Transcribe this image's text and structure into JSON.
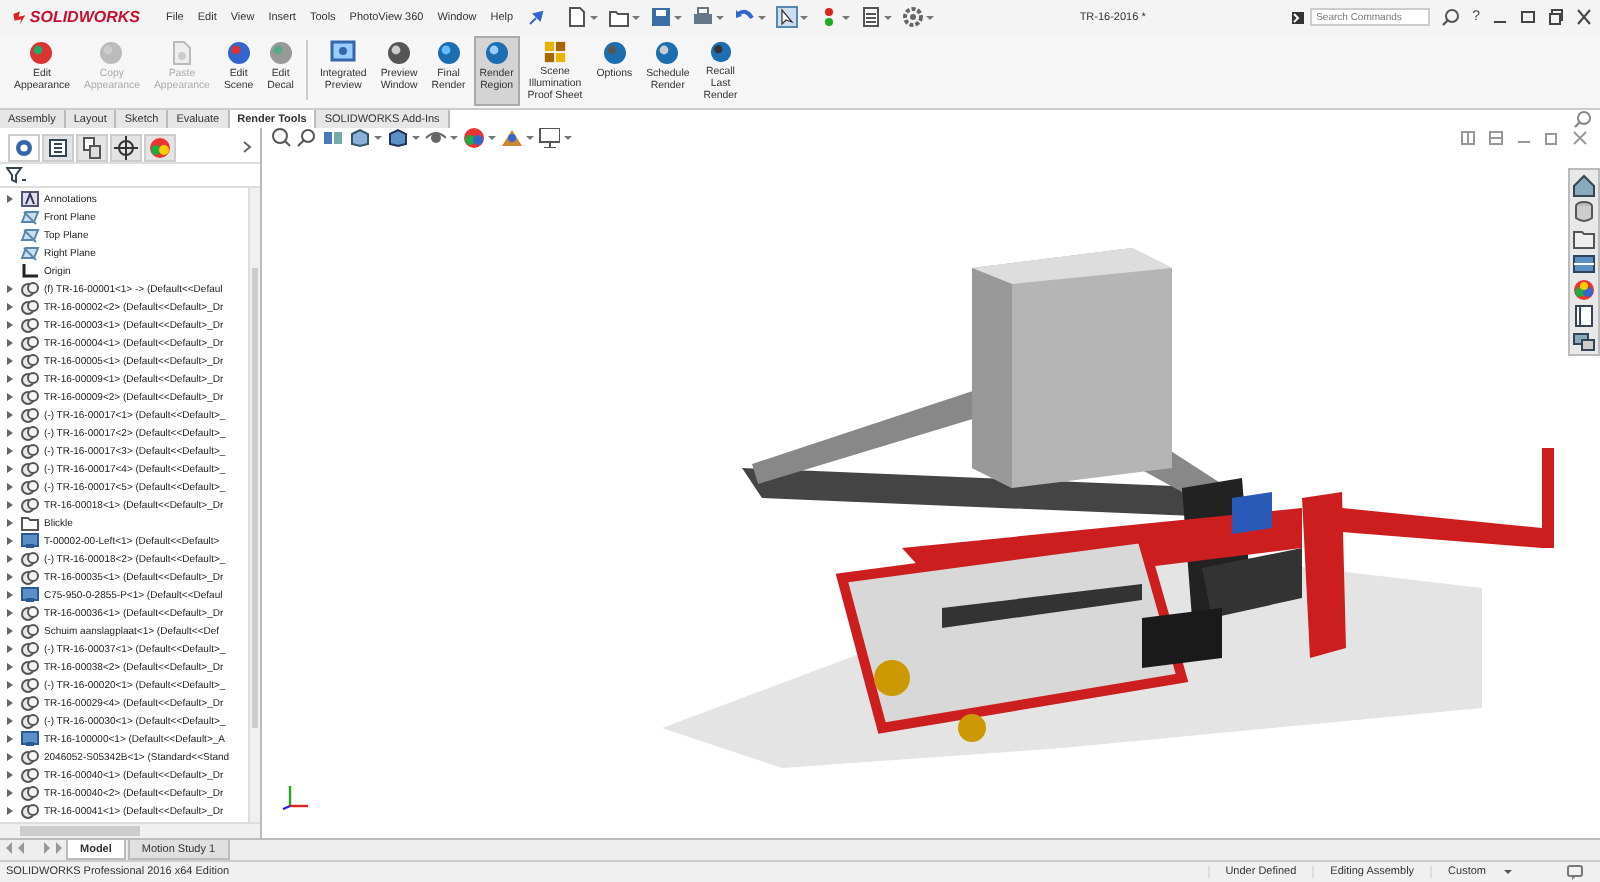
{
  "app": {
    "logo": "SOLIDWORKS"
  },
  "menu": [
    "File",
    "Edit",
    "View",
    "Insert",
    "Tools",
    "PhotoView 360",
    "Window",
    "Help"
  ],
  "document_title": "TR-16-2016 *",
  "search": {
    "placeholder": "Search Commands"
  },
  "help": "?",
  "ribbon": [
    {
      "label": "Edit\nAppearance",
      "disabled": false,
      "selected": false
    },
    {
      "label": "Copy\nAppearance",
      "disabled": true,
      "selected": false
    },
    {
      "label": "Paste\nAppearance",
      "disabled": true,
      "selected": false
    },
    {
      "label": "Edit\nScene",
      "disabled": false,
      "selected": false
    },
    {
      "label": "Edit\nDecal",
      "disabled": false,
      "selected": false
    },
    {
      "label": "Integrated\nPreview",
      "disabled": false,
      "selected": false
    },
    {
      "label": "Preview\nWindow",
      "disabled": false,
      "selected": false
    },
    {
      "label": "Final\nRender",
      "disabled": false,
      "selected": false
    },
    {
      "label": "Render\nRegion",
      "disabled": false,
      "selected": true
    },
    {
      "label": "Scene\nIllumination\nProof Sheet",
      "disabled": false,
      "selected": false
    },
    {
      "label": "Options",
      "disabled": false,
      "selected": false
    },
    {
      "label": "Schedule\nRender",
      "disabled": false,
      "selected": false
    },
    {
      "label": "Recall\nLast\nRender",
      "disabled": false,
      "selected": false
    }
  ],
  "command_tabs": [
    {
      "label": "Assembly",
      "selected": false
    },
    {
      "label": "Layout",
      "selected": false
    },
    {
      "label": "Sketch",
      "selected": false
    },
    {
      "label": "Evaluate",
      "selected": false
    },
    {
      "label": "Render Tools",
      "selected": true
    },
    {
      "label": "SOLIDWORKS Add-Ins",
      "selected": false
    }
  ],
  "feature_tree": [
    {
      "kind": "annotations",
      "label": "Annotations"
    },
    {
      "kind": "plane",
      "label": "Front Plane"
    },
    {
      "kind": "plane",
      "label": "Top Plane"
    },
    {
      "kind": "plane",
      "label": "Right Plane"
    },
    {
      "kind": "origin",
      "label": "Origin"
    },
    {
      "kind": "part",
      "label": "(f) TR-16-00001<1> -> (Default<<Defaul"
    },
    {
      "kind": "part",
      "label": "TR-16-00002<2> (Default<<Default>_Dr"
    },
    {
      "kind": "part",
      "label": "TR-16-00003<1> (Default<<Default>_Dr"
    },
    {
      "kind": "part",
      "label": "TR-16-00004<1> (Default<<Default>_Dr"
    },
    {
      "kind": "part",
      "label": "TR-16-00005<1> (Default<<Default>_Dr"
    },
    {
      "kind": "part",
      "label": "TR-16-00009<1> (Default<<Default>_Dr"
    },
    {
      "kind": "part",
      "label": "TR-16-00009<2> (Default<<Default>_Dr"
    },
    {
      "kind": "part",
      "label": "(-) TR-16-00017<1> (Default<<Default>_"
    },
    {
      "kind": "part",
      "label": "(-) TR-16-00017<2> (Default<<Default>_"
    },
    {
      "kind": "part",
      "label": "(-) TR-16-00017<3> (Default<<Default>_"
    },
    {
      "kind": "part",
      "label": "(-) TR-16-00017<4> (Default<<Default>_"
    },
    {
      "kind": "part",
      "label": "(-) TR-16-00017<5> (Default<<Default>_"
    },
    {
      "kind": "part",
      "label": "TR-16-00018<1> (Default<<Default>_Dr"
    },
    {
      "kind": "folder",
      "label": "Blickle"
    },
    {
      "kind": "assembly",
      "label": "T-00002-00-Left<1> (Default<<Default>"
    },
    {
      "kind": "part",
      "label": "(-) TR-16-00018<2> (Default<<Default>_"
    },
    {
      "kind": "part",
      "label": "TR-16-00035<1> (Default<<Default>_Dr"
    },
    {
      "kind": "assembly",
      "label": "C75-950-0-2855-P<1> (Default<<Defaul"
    },
    {
      "kind": "part",
      "label": "TR-16-00036<1> (Default<<Default>_Dr"
    },
    {
      "kind": "part",
      "label": "Schuim aanslagplaat<1> (Default<<Def"
    },
    {
      "kind": "part",
      "label": "(-) TR-16-00037<1> (Default<<Default>_"
    },
    {
      "kind": "part",
      "label": "TR-16-00038<2> (Default<<Default>_Dr"
    },
    {
      "kind": "part",
      "label": "(-) TR-16-00020<1> (Default<<Default>_"
    },
    {
      "kind": "part",
      "label": "TR-16-00029<4> (Default<<Default>_Dr"
    },
    {
      "kind": "part",
      "label": "(-) TR-16-00030<1> (Default<<Default>_"
    },
    {
      "kind": "assembly",
      "label": "TR-16-100000<1> (Default<<Default>_A"
    },
    {
      "kind": "part",
      "label": "2046052-S05342B<1> (Standard<<Stand"
    },
    {
      "kind": "part",
      "label": "TR-16-00040<1> (Default<<Default>_Dr"
    },
    {
      "kind": "part",
      "label": "TR-16-00040<2> (Default<<Default>_Dr"
    },
    {
      "kind": "part",
      "label": "TR-16-00041<1> (Default<<Default>_Dr"
    }
  ],
  "bottom_tabs": [
    {
      "label": "Model",
      "selected": true
    },
    {
      "label": "Motion Study 1",
      "selected": false
    }
  ],
  "status_bar": {
    "edition": "SOLIDWORKS Professional 2016 x64 Edition",
    "fields": [
      "Under Defined",
      "Editing Assembly",
      "Custom"
    ]
  }
}
